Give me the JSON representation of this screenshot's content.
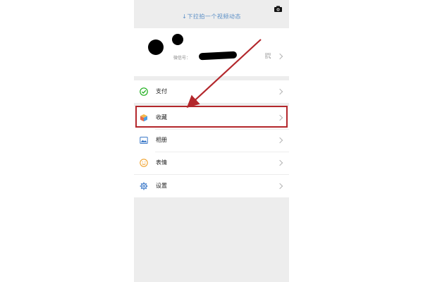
{
  "header": {
    "pull_hint": "↓下拉拍一个视频动态",
    "camera_icon": "camera-icon"
  },
  "profile": {
    "wechat_id_label": "微信号：",
    "qr_icon": "qr-code-icon"
  },
  "menu": {
    "pay": {
      "label": "支付",
      "icon": "pay-check-icon"
    },
    "favorites": {
      "label": "收藏",
      "icon": "favorites-cube-icon"
    },
    "album": {
      "label": "相册",
      "icon": "album-image-icon"
    },
    "stickers": {
      "label": "表情",
      "icon": "sticker-smile-icon"
    },
    "settings": {
      "label": "设置",
      "icon": "settings-gear-icon"
    }
  },
  "annotation": {
    "color": "#b3272c",
    "highlighted_item": "favorites"
  },
  "colors": {
    "background": "#ededed",
    "hint_blue": "#5b8fc6",
    "pay_green": "#1aad19",
    "sticker_orange": "#f0a22e",
    "settings_blue": "#3d7ac9"
  }
}
